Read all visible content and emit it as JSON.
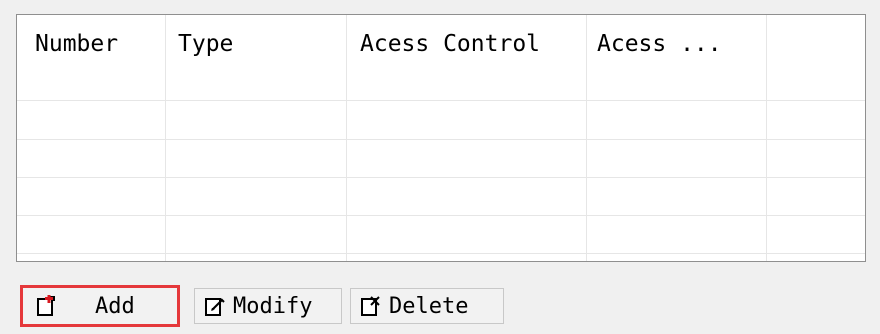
{
  "table": {
    "columns": [
      "Number",
      "Type",
      "Acess Control",
      "Acess ..."
    ],
    "rows": []
  },
  "toolbar": {
    "add_label": "Add",
    "modify_label": "Modify",
    "delete_label": "Delete",
    "add_icon": "add-document-icon",
    "modify_icon": "edit-document-icon",
    "delete_icon": "delete-document-icon"
  },
  "colors": {
    "highlight": "#e5383b",
    "table_bg": "#ffffff",
    "grid_line": "#e6e6e6",
    "window_bg": "#f0f0f0"
  }
}
